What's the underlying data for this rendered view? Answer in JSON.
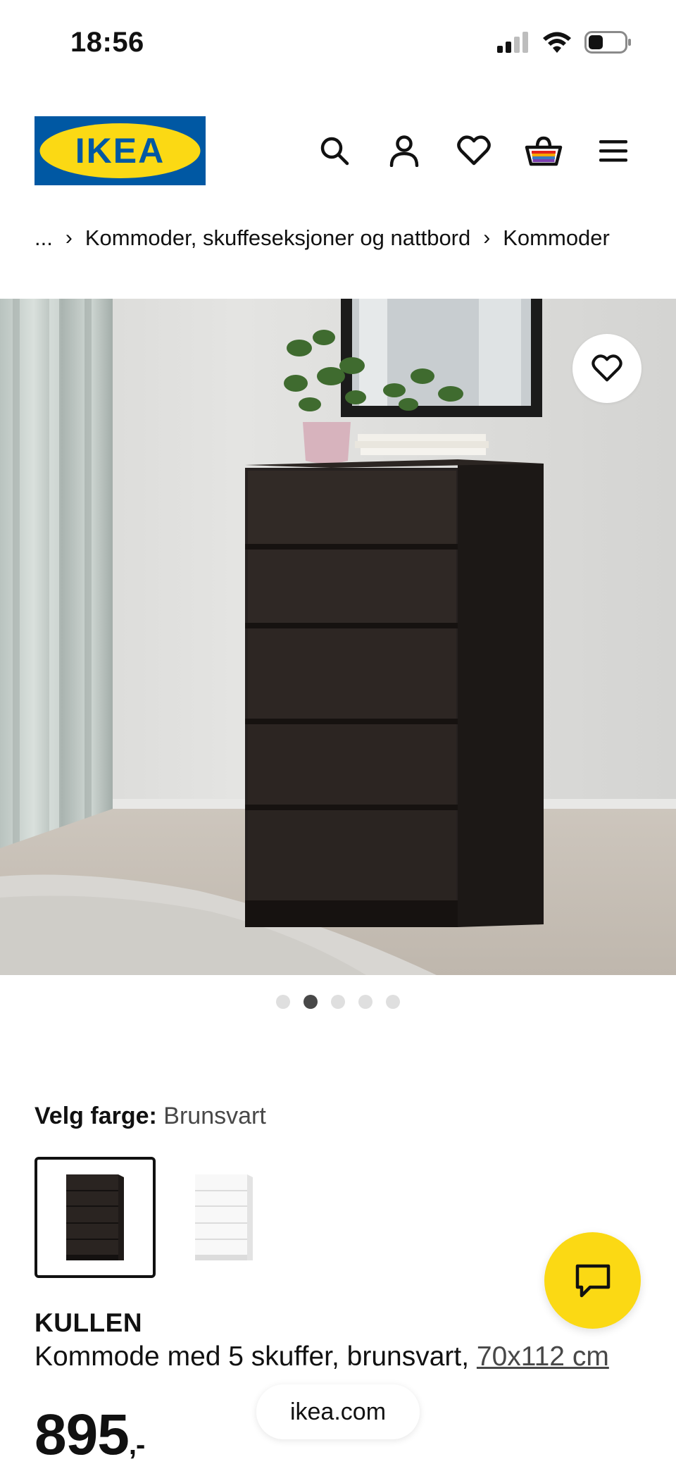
{
  "status_bar": {
    "time": "18:56"
  },
  "header": {
    "logo_text": "IKEA",
    "icons": [
      "search-icon",
      "account-icon",
      "favorites-icon",
      "cart-icon",
      "menu-icon"
    ]
  },
  "breadcrumb": {
    "items": [
      "...",
      "Kommoder, skuffeseksjoner og nattbord",
      "Kommoder"
    ]
  },
  "gallery": {
    "total": 5,
    "active_index": 1
  },
  "color_selector": {
    "label": "Velg farge:",
    "value": "Brunsvart",
    "options": [
      {
        "name": "brunsvart",
        "color": "#2a2420",
        "selected": true
      },
      {
        "name": "hvit",
        "color": "#ffffff",
        "selected": false
      }
    ]
  },
  "product": {
    "name": "KULLEN",
    "description": "Kommode med 5 skuffer, brunsvart,",
    "size": "70x112 cm",
    "price": "895",
    "price_suffix": ",-"
  },
  "browser": {
    "url": "ikea.com"
  },
  "colors": {
    "brand_blue": "#0058A3",
    "brand_yellow": "#FBD914"
  }
}
